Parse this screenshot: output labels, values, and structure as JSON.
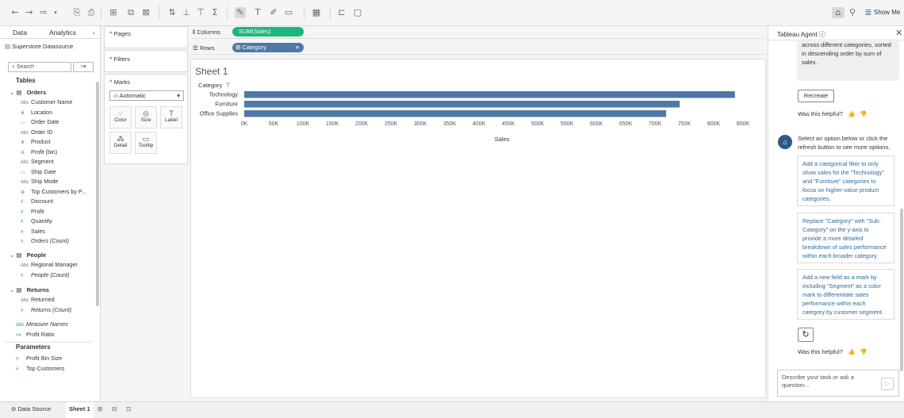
{
  "toolbar": {
    "show_me_label": "Show Me"
  },
  "data_pane": {
    "tabs": [
      "Data",
      "Analytics"
    ],
    "collapse_glyph": "‹",
    "datasource": "Superstore Datasource",
    "search_placeholder": "Search",
    "tables_title": "Tables",
    "orders": {
      "name": "Orders",
      "fields": [
        {
          "icon": "Abc",
          "label": "Customer Name",
          "type": "dim"
        },
        {
          "icon": "⋔",
          "label": "Location",
          "type": "geo"
        },
        {
          "icon": "▭",
          "label": "Order Date",
          "type": "date"
        },
        {
          "icon": "Abc",
          "label": "Order ID",
          "type": "dim"
        },
        {
          "icon": "⋔",
          "label": "Product",
          "type": "geo"
        },
        {
          "icon": "ılı",
          "label": "Profit (bin)",
          "type": "dim"
        },
        {
          "icon": "Abc",
          "label": "Segment",
          "type": "dim"
        },
        {
          "icon": "▭",
          "label": "Ship Date",
          "type": "date"
        },
        {
          "icon": "Abc",
          "label": "Ship Mode",
          "type": "dim"
        },
        {
          "icon": "⊕",
          "label": "Top Customers by P...",
          "type": "dim"
        },
        {
          "icon": "#",
          "label": "Discount",
          "type": "measure"
        },
        {
          "icon": "#",
          "label": "Profit",
          "type": "measure"
        },
        {
          "icon": "#",
          "label": "Quantity",
          "type": "measure"
        },
        {
          "icon": "#",
          "label": "Sales",
          "type": "measure"
        },
        {
          "icon": "#",
          "label": "Orders (Count)",
          "type": "measure-italic"
        }
      ]
    },
    "people": {
      "name": "People",
      "fields": [
        {
          "icon": "Abc",
          "label": "Regional Manager",
          "type": "dim"
        },
        {
          "icon": "#",
          "label": "People (Count)",
          "type": "measure-italic"
        }
      ]
    },
    "returns": {
      "name": "Returns",
      "fields": [
        {
          "icon": "Abc",
          "label": "Returned",
          "type": "dim"
        },
        {
          "icon": "#",
          "label": "Returns (Count)",
          "type": "measure-italic"
        }
      ]
    },
    "extra_fields": [
      {
        "icon": "Abc",
        "label": "Measure Names",
        "type": "dim-italic"
      },
      {
        "icon": "=#",
        "label": "Profit Ratio",
        "type": "measure"
      }
    ],
    "parameters_title": "Parameters",
    "parameters": [
      {
        "icon": "#",
        "label": "Profit Bin Size"
      },
      {
        "icon": "#",
        "label": "Top Customers"
      }
    ]
  },
  "cards": {
    "pages": "Pages",
    "filters": "Filters",
    "marks": "Marks",
    "mark_type": "Automatic",
    "mark_buttons": [
      {
        "label": "Color",
        "icon": "⁘"
      },
      {
        "label": "Size",
        "icon": "◎"
      },
      {
        "label": "Label",
        "icon": "T"
      },
      {
        "label": "Detail",
        "icon": "⁂"
      },
      {
        "label": "Tooltip",
        "icon": "▭"
      }
    ]
  },
  "shelves": {
    "columns_label": "Columns",
    "columns_pill": "SUM(Sales)",
    "rows_label": "Rows",
    "rows_pill": "Category"
  },
  "sheet": {
    "title": "Sheet 1"
  },
  "chart_data": {
    "type": "bar",
    "orientation": "horizontal",
    "row_header": "Category",
    "categories": [
      "Technology",
      "Furniture",
      "Office Supplies"
    ],
    "values": [
      836154,
      741999,
      719047
    ],
    "xlabel": "Sales",
    "xticks": [
      "0K",
      "50K",
      "100K",
      "150K",
      "200K",
      "250K",
      "300K",
      "350K",
      "400K",
      "450K",
      "500K",
      "550K",
      "600K",
      "650K",
      "700K",
      "750K",
      "800K",
      "850K"
    ],
    "xlim": [
      0,
      850000
    ],
    "bar_color": "#4e79a7"
  },
  "agent": {
    "title": "Tableau Agent",
    "bubble_text": "across different categories, sorted in descending order by sum of sales.",
    "recreate_label": "Recreate",
    "helpful_label": "Was this helpful?",
    "intro_text": "Select an option below or click the refresh button to see more options.",
    "suggestions": [
      "Add a categorical filter to only show sales for the \"Technology\" and \"Furniture\" categories to focus on higher-value product categories.",
      "Replace \"Category\" with \"Sub-Category\" on the y-axis to provide a more detailed breakdown of sales performance within each broader category.",
      "Add a new field as a mark by including \"Segment\" as a color mark to differentiate sales performance within each category by customer segment."
    ],
    "input_placeholder": "Describe your task or ask a question..."
  },
  "bottom_tabs": {
    "datasource": "Data Source",
    "sheet": "Sheet 1"
  }
}
